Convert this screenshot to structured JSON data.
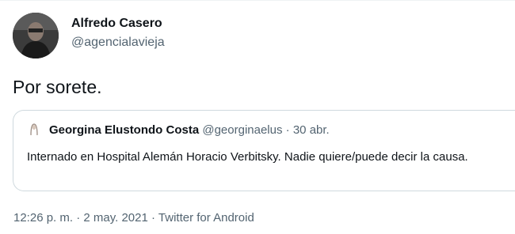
{
  "tweet": {
    "author": {
      "name": "Alfredo Casero",
      "handle": "@agencialavieja"
    },
    "text": "Por sorete.",
    "quote": {
      "author_name": "Georgina Elustondo Costa",
      "author_handle": "@georginaelus",
      "separator": "·",
      "date": "30 abr.",
      "text": "Internado en Hospital Alemán Horacio Verbitsky. Nadie quiere/puede decir la causa."
    },
    "footer": {
      "time": "12:26 p. m.",
      "sep1": "·",
      "date": "2 may. 2021",
      "sep2": "·",
      "source": "Twitter for Android"
    }
  },
  "colors": {
    "text_primary": "#0f1419",
    "text_secondary": "#536471",
    "border": "#cfd9de"
  },
  "icons": {
    "author_avatar": "avatar-photo",
    "quote_avatar": "avatar-photo-small"
  }
}
